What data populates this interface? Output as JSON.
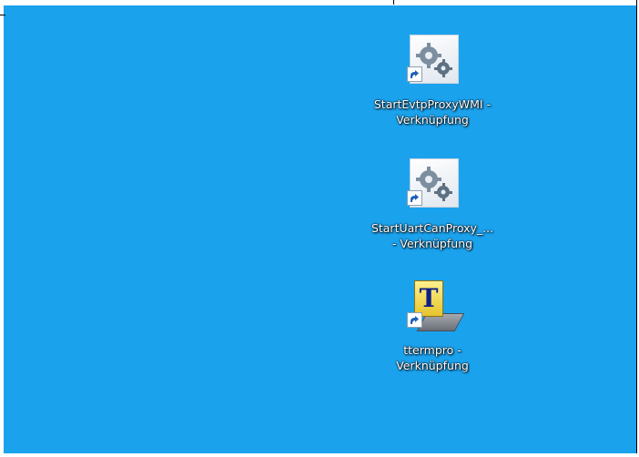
{
  "desktop": {
    "background_color": "#1ba2ed",
    "icons": [
      {
        "label": "StartEvtpProxyWMI -\nVerknüpfung",
        "icon": "gear-config-icon",
        "shortcut": true
      },
      {
        "label": "StartUartCanProxy_...\n- Verknüpfung",
        "icon": "gear-config-icon",
        "shortcut": true
      },
      {
        "label": "ttermpro -\nVerknüpfung",
        "icon": "teraterm-icon",
        "shortcut": true
      }
    ]
  }
}
